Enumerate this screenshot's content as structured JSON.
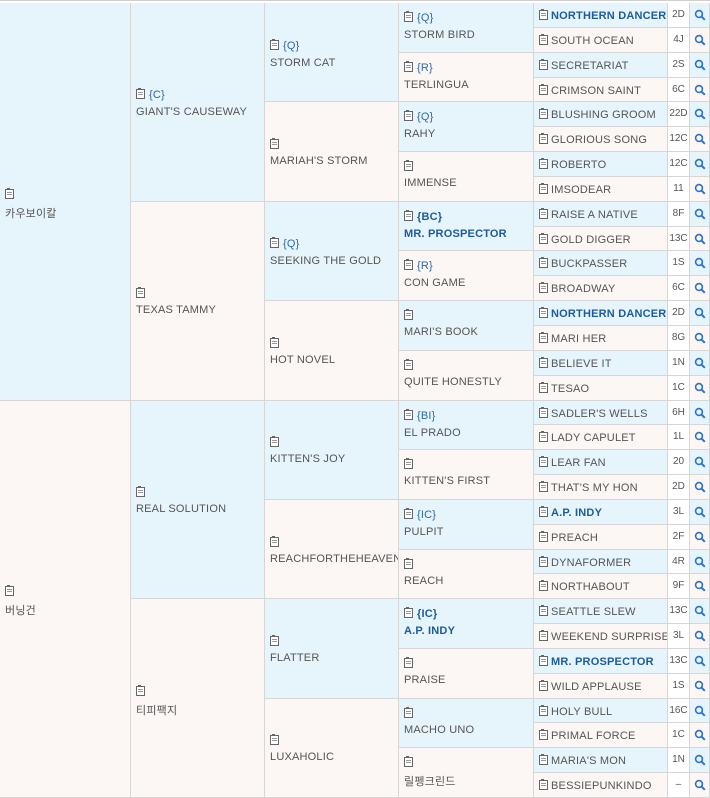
{
  "generations": {
    "g1": [
      {
        "name": "카우보이칼",
        "tag": "",
        "bold": false,
        "bg": "m"
      },
      {
        "name": "버닝건",
        "tag": "",
        "bold": false,
        "bg": "f"
      }
    ],
    "g2": [
      {
        "name": "GIANT'S CAUSEWAY",
        "tag": "{C}",
        "bold": false,
        "bg": "m"
      },
      {
        "name": "TEXAS TAMMY",
        "tag": "",
        "bold": false,
        "bg": "f"
      },
      {
        "name": "REAL SOLUTION",
        "tag": "",
        "bold": false,
        "bg": "m"
      },
      {
        "name": "티피팩지",
        "tag": "",
        "bold": false,
        "bg": "f"
      }
    ],
    "g3": [
      {
        "name": "STORM CAT",
        "tag": "{Q}",
        "bold": false,
        "bg": "m"
      },
      {
        "name": "MARIAH'S STORM",
        "tag": "",
        "bold": false,
        "bg": "f"
      },
      {
        "name": "SEEKING THE GOLD",
        "tag": "{Q}",
        "bold": false,
        "bg": "m"
      },
      {
        "name": "HOT NOVEL",
        "tag": "",
        "bold": false,
        "bg": "f"
      },
      {
        "name": "KITTEN'S JOY",
        "tag": "",
        "bold": false,
        "bg": "m"
      },
      {
        "name": "REACHFORTHEHEAVENS",
        "tag": "",
        "bold": false,
        "bg": "f"
      },
      {
        "name": "FLATTER",
        "tag": "",
        "bold": false,
        "bg": "m"
      },
      {
        "name": "LUXAHOLIC",
        "tag": "",
        "bold": false,
        "bg": "f"
      }
    ],
    "g4": [
      {
        "name": "STORM BIRD",
        "tag": "{Q}",
        "bold": false,
        "bg": "m"
      },
      {
        "name": "TERLINGUA",
        "tag": "{R}",
        "bold": false,
        "bg": "f"
      },
      {
        "name": "RAHY",
        "tag": "{Q}",
        "bold": false,
        "bg": "m"
      },
      {
        "name": "IMMENSE",
        "tag": "",
        "bold": false,
        "bg": "f"
      },
      {
        "name": "MR. PROSPECTOR",
        "tag": "{BC}",
        "bold": true,
        "bg": "m"
      },
      {
        "name": "CON GAME",
        "tag": "{R}",
        "bold": false,
        "bg": "f"
      },
      {
        "name": "MARI'S BOOK",
        "tag": "",
        "bold": false,
        "bg": "m"
      },
      {
        "name": "QUITE HONESTLY",
        "tag": "",
        "bold": false,
        "bg": "f"
      },
      {
        "name": "EL PRADO",
        "tag": "{BI}",
        "bold": false,
        "bg": "m"
      },
      {
        "name": "KITTEN'S FIRST",
        "tag": "",
        "bold": false,
        "bg": "f"
      },
      {
        "name": "PULPIT",
        "tag": "{IC}",
        "bold": false,
        "bg": "m"
      },
      {
        "name": "REACH",
        "tag": "",
        "bold": false,
        "bg": "f"
      },
      {
        "name": "A.P. INDY",
        "tag": "{IC}",
        "bold": true,
        "bg": "m"
      },
      {
        "name": "PRAISE",
        "tag": "",
        "bold": false,
        "bg": "f"
      },
      {
        "name": "MACHO UNO",
        "tag": "",
        "bold": false,
        "bg": "m"
      },
      {
        "name": "릴펭크린드",
        "tag": "",
        "bold": false,
        "bg": "f"
      }
    ],
    "g5": [
      {
        "name": "NORTHERN DANCER",
        "code": "2D",
        "bold": true,
        "bg": "m"
      },
      {
        "name": "SOUTH OCEAN",
        "code": "4J",
        "bold": false,
        "bg": "f"
      },
      {
        "name": "SECRETARIAT",
        "code": "2S",
        "bold": false,
        "bg": "m"
      },
      {
        "name": "CRIMSON SAINT",
        "code": "6C",
        "bold": false,
        "bg": "f"
      },
      {
        "name": "BLUSHING GROOM",
        "code": "22D",
        "bold": false,
        "bg": "m"
      },
      {
        "name": "GLORIOUS SONG",
        "code": "12C",
        "bold": false,
        "bg": "f"
      },
      {
        "name": "ROBERTO",
        "code": "12C",
        "bold": false,
        "bg": "m"
      },
      {
        "name": "IMSODEAR",
        "code": "11",
        "bold": false,
        "bg": "f"
      },
      {
        "name": "RAISE A NATIVE",
        "code": "8F",
        "bold": false,
        "bg": "m"
      },
      {
        "name": "GOLD DIGGER",
        "code": "13C",
        "bold": false,
        "bg": "f"
      },
      {
        "name": "BUCKPASSER",
        "code": "1S",
        "bold": false,
        "bg": "m"
      },
      {
        "name": "BROADWAY",
        "code": "6C",
        "bold": false,
        "bg": "f"
      },
      {
        "name": "NORTHERN DANCER",
        "code": "2D",
        "bold": true,
        "bg": "m"
      },
      {
        "name": "MARI HER",
        "code": "8G",
        "bold": false,
        "bg": "f"
      },
      {
        "name": "BELIEVE IT",
        "code": "1N",
        "bold": false,
        "bg": "m"
      },
      {
        "name": "TESAO",
        "code": "1C",
        "bold": false,
        "bg": "f"
      },
      {
        "name": "SADLER'S WELLS",
        "code": "6H",
        "bold": false,
        "bg": "m"
      },
      {
        "name": "LADY CAPULET",
        "code": "1L",
        "bold": false,
        "bg": "f"
      },
      {
        "name": "LEAR FAN",
        "code": "20",
        "bold": false,
        "bg": "m"
      },
      {
        "name": "THAT'S MY HON",
        "code": "2D",
        "bold": false,
        "bg": "f"
      },
      {
        "name": "A.P. INDY",
        "code": "3L",
        "bold": true,
        "bg": "m"
      },
      {
        "name": "PREACH",
        "code": "2F",
        "bold": false,
        "bg": "f"
      },
      {
        "name": "DYNAFORMER",
        "code": "4R",
        "bold": false,
        "bg": "m"
      },
      {
        "name": "NORTHABOUT",
        "code": "9F",
        "bold": false,
        "bg": "f"
      },
      {
        "name": "SEATTLE SLEW",
        "code": "13C",
        "bold": false,
        "bg": "m"
      },
      {
        "name": "WEEKEND SURPRISE",
        "code": "3L",
        "bold": false,
        "bg": "f"
      },
      {
        "name": "MR. PROSPECTOR",
        "code": "13C",
        "bold": true,
        "bg": "m"
      },
      {
        "name": "WILD APPLAUSE",
        "code": "1S",
        "bold": false,
        "bg": "f"
      },
      {
        "name": "HOLY BULL",
        "code": "16C",
        "bold": false,
        "bg": "m"
      },
      {
        "name": "PRIMAL FORCE",
        "code": "1C",
        "bold": false,
        "bg": "f"
      },
      {
        "name": "MARIA'S MON",
        "code": "1N",
        "bold": false,
        "bg": "m"
      },
      {
        "name": "BESSIEPUNKINDO",
        "code": "–",
        "bold": false,
        "bg": "f"
      }
    ]
  },
  "icons": {
    "document": "document-icon",
    "search": "magnifier-icon"
  },
  "colors": {
    "sire_bg": "#e6f4fb",
    "dam_bg": "#fcf6f5",
    "link": "#1e5c99",
    "search_blue": "#2a73c9"
  }
}
